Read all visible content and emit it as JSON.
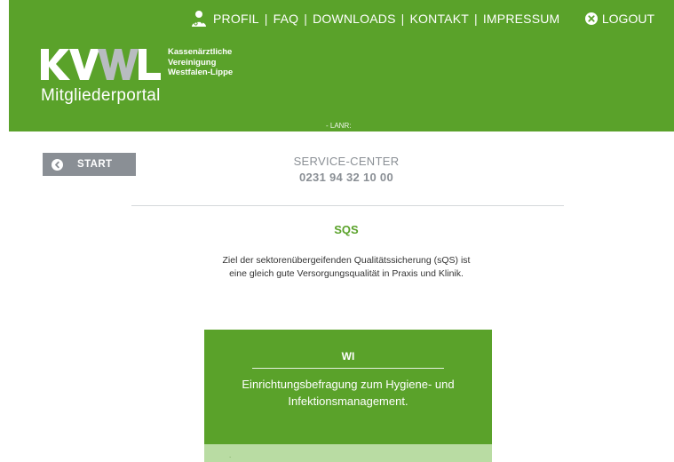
{
  "header": {
    "nav": [
      "PROFIL",
      "FAQ",
      "DOWNLOADS",
      "KONTAKT",
      "IMPRESSUM"
    ],
    "nav_icon": "profile-doctor-icon",
    "logout_label": "LOGOUT",
    "logout_icon": "close-circle-icon",
    "logo_text": "KVWL",
    "logo_sub": [
      "Kassenärztliche",
      "Vereinigung",
      "Westfalen-Lippe"
    ],
    "portal_title": "Mitgliederportal",
    "lanr": "- LANR:"
  },
  "start_button": {
    "label": "START",
    "icon": "chevron-left-circle-icon"
  },
  "service_center": {
    "label": "SERVICE-CENTER",
    "phone": "0231 94 32 10 00"
  },
  "page": {
    "title": "SQS",
    "intro_line1": "Ziel der sektorenübergeifenden Qualitätssicherung (sQS) ist",
    "intro_line2": "eine gleich gute Versorgungsqualität in Praxis und Klinik."
  },
  "card": {
    "title": "WI",
    "desc_line1": "Einrichtungsbefragung zum Hygiene- und",
    "desc_line2": "Infektionsmanagement.",
    "footer_mark": "."
  },
  "colors": {
    "brand_green": "#5aa22a",
    "light_green": "#b9dca3",
    "gray": "#8a8f95"
  }
}
